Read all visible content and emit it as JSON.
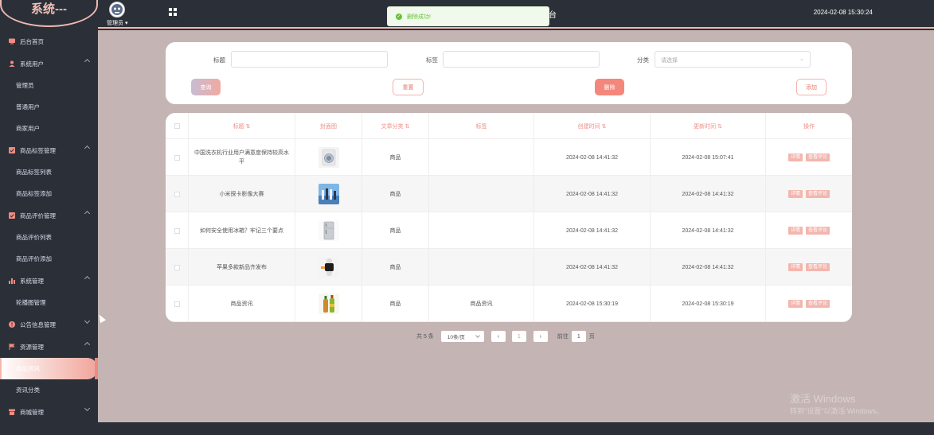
{
  "app": {
    "logo_text": "系统---",
    "title_tail": "台",
    "datetime": "2024-02-08 15:30:24",
    "user": "管理员"
  },
  "toast": {
    "text": "删除成功!"
  },
  "colors": {
    "sidebar": "#2b3038",
    "main_bg": "#c4b5b4",
    "accent": "#f08a7d",
    "header_text": "#ef8d84"
  },
  "sidebar": {
    "items": [
      {
        "label": "后台首页",
        "icon": "monitor-icon",
        "type": "item"
      },
      {
        "label": "系统用户",
        "icon": "user-icon",
        "type": "group",
        "open": true
      },
      {
        "label": "管理员",
        "type": "sub"
      },
      {
        "label": "普通用户",
        "type": "sub"
      },
      {
        "label": "商家用户",
        "type": "sub"
      },
      {
        "label": "商品标签管理",
        "icon": "checkbox-icon",
        "type": "group",
        "open": true
      },
      {
        "label": "商品标签列表",
        "type": "sub"
      },
      {
        "label": "商品标签添加",
        "type": "sub"
      },
      {
        "label": "商品评价管理",
        "icon": "checkbox-icon",
        "type": "group",
        "open": true
      },
      {
        "label": "商品评价列表",
        "type": "sub"
      },
      {
        "label": "商品评价添加",
        "type": "sub"
      },
      {
        "label": "系统管理",
        "icon": "chart-icon",
        "type": "group",
        "open": true
      },
      {
        "label": "轮播图管理",
        "type": "sub"
      },
      {
        "label": "公告信息管理",
        "icon": "info-icon",
        "type": "group",
        "open": false
      },
      {
        "label": "资源管理",
        "icon": "flag-icon",
        "type": "group",
        "open": true
      },
      {
        "label": "商品资讯",
        "type": "sub",
        "active": true
      },
      {
        "label": "资讯分类",
        "type": "sub"
      },
      {
        "label": "商城管理",
        "icon": "shop-icon",
        "type": "group",
        "open": false
      }
    ]
  },
  "search": {
    "title_label": "标题",
    "title_value": "",
    "tag_label": "标签",
    "tag_value": "",
    "category_label": "分类",
    "category_placeholder": "请选择",
    "query_btn": "查询",
    "reset_btn": "重置",
    "delete_btn": "删除",
    "add_btn": "添加"
  },
  "table": {
    "headers": [
      "标题",
      "封面图",
      "文章分类",
      "标签",
      "创建时间",
      "更新时间",
      "操作"
    ],
    "rows": [
      {
        "title": "中国洗衣机行业用户满意度保持较高水平",
        "category": "商品",
        "tag": "",
        "created": "2024-02-08 14:41:32",
        "updated": "2024-02-08 15:07:41",
        "thumb": "washer"
      },
      {
        "title": "小米探卡影像大赛",
        "category": "商品",
        "tag": "",
        "created": "2024-02-08 14:41:32",
        "updated": "2024-02-08 14:41:32",
        "thumb": "people"
      },
      {
        "title": "如何安全使用冰箱？牢记三个要点",
        "category": "商品",
        "tag": "",
        "created": "2024-02-08 14:41:32",
        "updated": "2024-02-08 14:41:32",
        "thumb": "fridge"
      },
      {
        "title": "苹果多款新品齐发布",
        "category": "商品",
        "tag": "",
        "created": "2024-02-08 14:41:32",
        "updated": "2024-02-08 14:41:32",
        "thumb": "watch"
      },
      {
        "title": "商品资讯",
        "category": "商品",
        "tag": "商品资讯",
        "created": "2024-02-08 15:30:19",
        "updated": "2024-02-08 15:30:19",
        "thumb": "bottles"
      }
    ],
    "op_detail": "详情",
    "op_comment": "查看评论"
  },
  "pagination": {
    "total": "共 5 条",
    "size": "10条/页",
    "page": "1",
    "goto_prefix": "前往",
    "goto_value": "1",
    "goto_suffix": "页"
  },
  "watermark": {
    "line1": "激活 Windows",
    "line2": "转到\"设置\"以激活 Windows。"
  }
}
